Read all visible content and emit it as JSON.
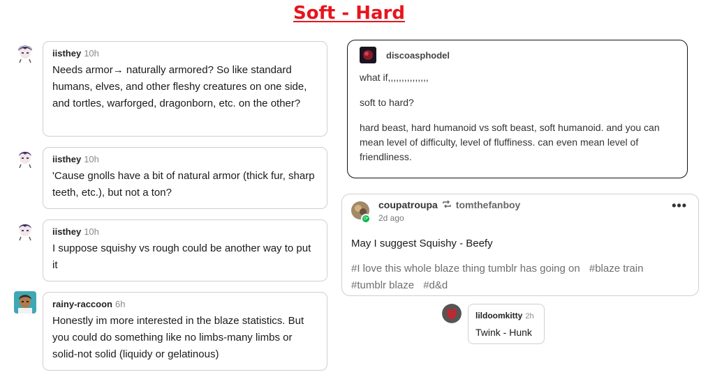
{
  "title": "Soft - Hard",
  "comments": [
    {
      "user": "iisthey",
      "time": "10h",
      "text": "Needs armor→ naturally armored? So like standard humans, elves, and other fleshy creatures on one side, and tortles, warforged, dragonborn, etc. on the other?"
    },
    {
      "user": "iisthey",
      "time": "10h",
      "text": "'Cause gnolls have a bit of natural armor (thick fur, sharp teeth, etc.), but not a ton?"
    },
    {
      "user": "iisthey",
      "time": "10h",
      "text": "I suppose squishy vs rough could be another way to put it"
    },
    {
      "user": "rainy-raccoon",
      "time": "6h",
      "text": "Honestly im more interested in the blaze statistics. But you could do something like no limbs-many limbs or solid-not solid (liquidy or gelatinous)"
    }
  ],
  "post": {
    "user": "discoasphodel",
    "paragraphs": [
      "what if,,,,,,,,,,,,,,,",
      "soft to hard?",
      "hard beast, hard humanoid vs soft beast, soft humanoid. and you can mean level of difficulty, level of fluffiness. can even mean level of friendliness."
    ]
  },
  "reblog": {
    "user": "coupatroupa",
    "reblogged_from": "tomthefanboy",
    "time": "2d ago",
    "more": "•••",
    "body": "May I suggest Squishy - Beefy",
    "tags": [
      "#I love this whole blaze thing tumblr has going on",
      "#blaze train",
      "#tumblr blaze",
      "#d&d"
    ]
  },
  "reply": {
    "user": "lildoomkitty",
    "time": "2h",
    "text": "Twink - Hunk"
  },
  "colors": {
    "title": "#e8141d",
    "reblog_badge": "#00b84a",
    "border": "#cfcfcf"
  }
}
